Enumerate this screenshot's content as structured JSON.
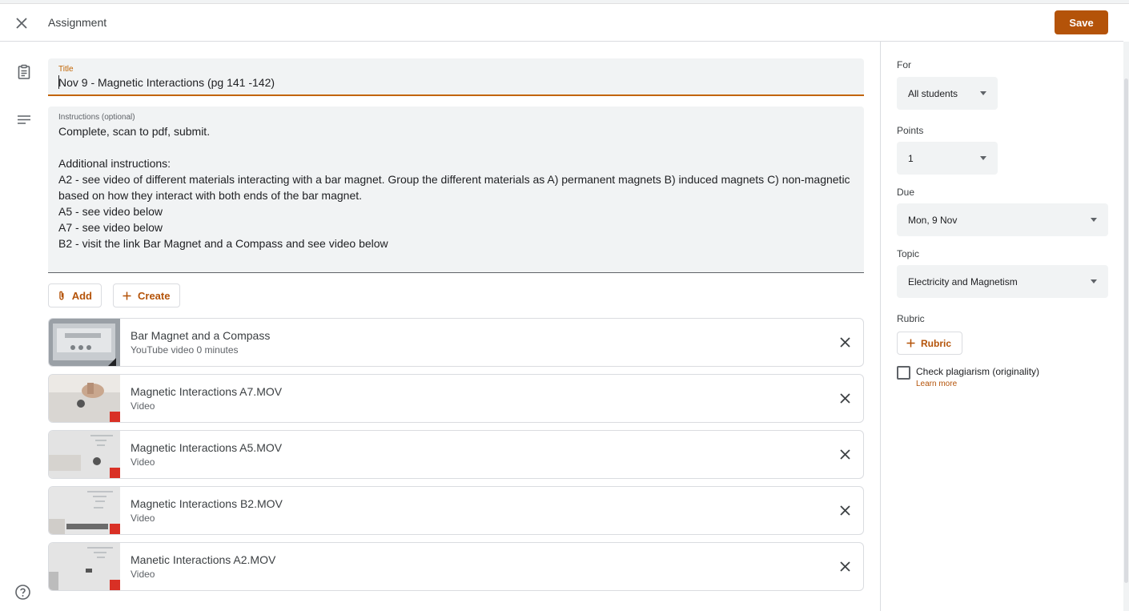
{
  "header": {
    "title": "Assignment",
    "save_label": "Save"
  },
  "title_field": {
    "label": "Title",
    "value": "Nov 9 - Magnetic Interactions (pg 141 -142)"
  },
  "instructions_field": {
    "label": "Instructions (optional)",
    "value": "Complete, scan to pdf, submit.\n\nAdditional instructions:\nA2 - see video of different materials interacting with a bar magnet.  Group the different materials as A) permanent magnets B) induced magnets C) non-magnetic based on how they interact with both ends of the bar magnet.\nA5 - see video below\nA7 - see video below\nB2 - visit the link Bar Magnet and a Compass and see video below"
  },
  "actions": {
    "add_label": "Add",
    "create_label": "Create"
  },
  "attachments": [
    {
      "title": "Bar Magnet and a Compass",
      "subtitle": "YouTube video   0 minutes"
    },
    {
      "title": "Magnetic Interactions A7.MOV",
      "subtitle": "Video"
    },
    {
      "title": "Magnetic Interactions A5.MOV",
      "subtitle": "Video"
    },
    {
      "title": "Magnetic Interactions B2.MOV",
      "subtitle": "Video"
    },
    {
      "title": "Manetic Interactions A2.MOV",
      "subtitle": "Video"
    }
  ],
  "sidebar": {
    "for_label": "For",
    "for_value": "All students",
    "points_label": "Points",
    "points_value": "1",
    "due_label": "Due",
    "due_value": "Mon, 9 Nov",
    "topic_label": "Topic",
    "topic_value": "Electricity and Magnetism",
    "rubric_label": "Rubric",
    "rubric_button": "Rubric",
    "plagiarism_label": "Check plagiarism (originality)",
    "learn_more": "Learn more"
  },
  "icons": {
    "close": "close-icon",
    "assignment": "assignment-icon",
    "notes": "notes-icon",
    "help": "help-icon",
    "paperclip": "paperclip-icon",
    "plus": "plus-icon",
    "dropdown": "dropdown-arrow-icon"
  },
  "colors": {
    "accent": "#b45309",
    "focus_underline": "#c26401",
    "field_bg": "#f1f3f4",
    "border": "#dadce0"
  }
}
